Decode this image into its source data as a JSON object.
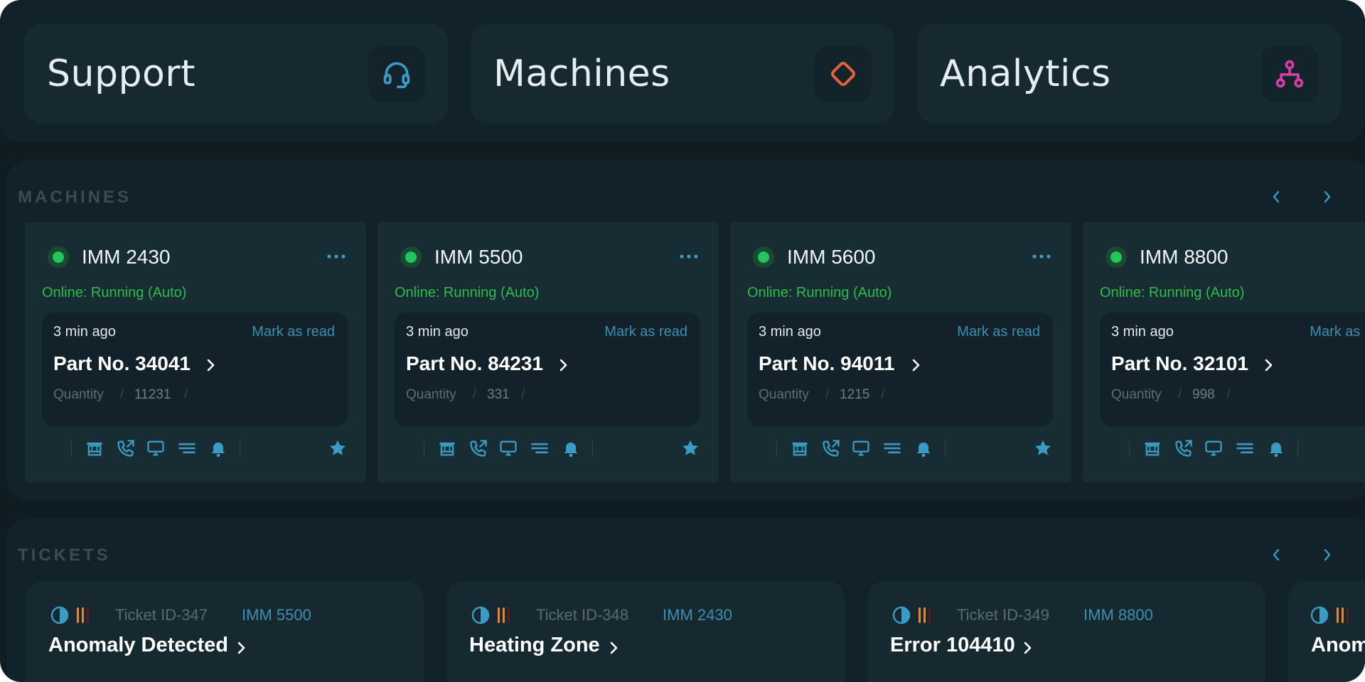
{
  "nav": {
    "support": {
      "label": "Support",
      "icon": "headset-icon",
      "color": "#3a9bc4"
    },
    "machines": {
      "label": "Machines",
      "icon": "diamond-icon",
      "color": "#e2623a"
    },
    "analytics": {
      "label": "Analytics",
      "icon": "hierarchy-icon",
      "color": "#d63fa8"
    }
  },
  "machines_section": {
    "title": "MACHINES",
    "cards": [
      {
        "name": "IMM 2430",
        "status": "Online: Running (Auto)",
        "ago": "3 min ago",
        "mark": "Mark as read",
        "part": "Part No. 34041",
        "qty_label": "Quantity",
        "qty": "11231"
      },
      {
        "name": "IMM 5500",
        "status": "Online: Running (Auto)",
        "ago": "3 min ago",
        "mark": "Mark as read",
        "part": "Part No. 84231",
        "qty_label": "Quantity",
        "qty": "331"
      },
      {
        "name": "IMM 5600",
        "status": "Online: Running (Auto)",
        "ago": "3 min ago",
        "mark": "Mark as read",
        "part": "Part No. 94011",
        "qty_label": "Quantity",
        "qty": "1215"
      },
      {
        "name": "IMM 8800",
        "status": "Online: Running (Auto)",
        "ago": "3 min ago",
        "mark": "Mark as read",
        "part": "Part No. 32101",
        "qty_label": "Quantity",
        "qty": "998"
      }
    ]
  },
  "tickets_section": {
    "title": "TICKETS",
    "cards": [
      {
        "id": "Ticket ID-347",
        "machine": "IMM 5500",
        "title": "Anomaly Detected"
      },
      {
        "id": "Ticket ID-348",
        "machine": "IMM 2430",
        "title": "Heating Zone"
      },
      {
        "id": "Ticket ID-349",
        "machine": "IMM 8800",
        "title": "Error 104410"
      },
      {
        "id": "",
        "machine": "",
        "title": "Anomaly Detected"
      }
    ]
  },
  "colors": {
    "accent": "#3b9cc3",
    "online": "#2ebd4a",
    "priority_orange": "#e8843a",
    "priority_red": "#5a1e1e"
  }
}
